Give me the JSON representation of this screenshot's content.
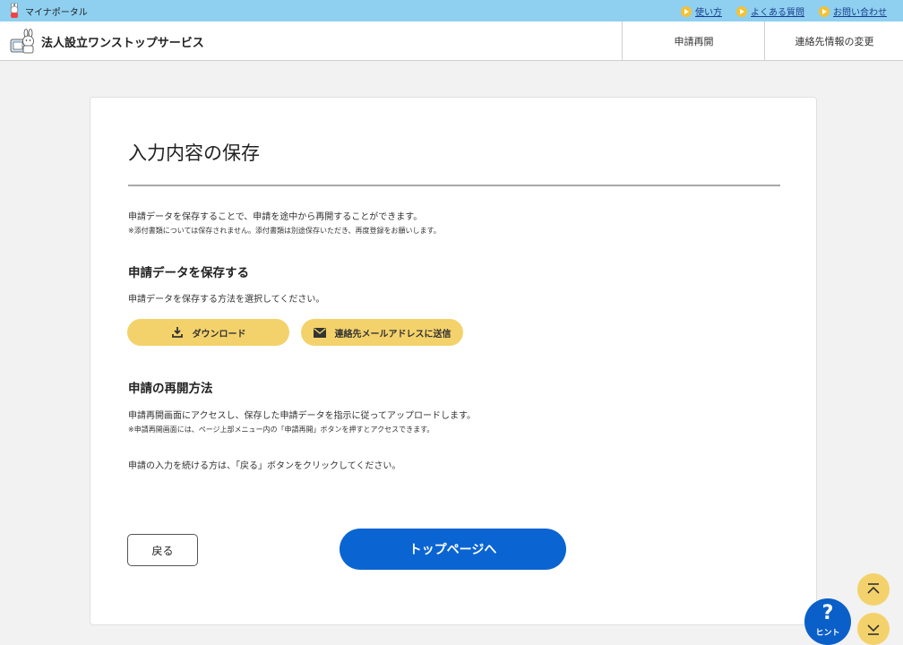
{
  "topbar": {
    "portal_name": "マイナポータル",
    "links": [
      "使い方",
      "よくある質問",
      "お問い合わせ"
    ]
  },
  "header": {
    "title": "法人設立ワンストップサービス",
    "nav": [
      "申請再開",
      "連絡先情報の変更"
    ]
  },
  "main": {
    "title": "入力内容の保存",
    "intro": "申請データを保存することで、申請を途中から再開することができます。",
    "intro_note": "※添付書類については保存されません。添付書類は別途保存いただき、再度登録をお願いします。",
    "save_heading": "申請データを保存する",
    "save_desc": "申請データを保存する方法を選択してください。",
    "download_label": "ダウンロード",
    "email_label": "連絡先メールアドレスに送信",
    "resume_heading": "申請の再開方法",
    "resume_desc": "申請再開画面にアクセスし、保存した申請データを指示に従ってアップロードします。",
    "resume_note": "※申請再開画面には、ページ上部メニュー内の「申請再開」ボタンを押すとアクセスできます。",
    "continue_text": "申請の入力を続ける方は、「戻る」ボタンをクリックしてください。",
    "back_label": "戻る",
    "top_label": "トップページへ"
  },
  "floating": {
    "hint_symbol": "?",
    "hint_label": "ヒント"
  },
  "colors": {
    "topbar": "#8fd0f0",
    "primary": "#0a64d2",
    "accent": "#f4d26b"
  },
  "icons": [
    "portal-mascot-icon",
    "brand-mascot-icon",
    "play-bullet-icon",
    "download-icon",
    "mail-icon",
    "question-icon",
    "scroll-top-icon",
    "scroll-bottom-icon"
  ]
}
